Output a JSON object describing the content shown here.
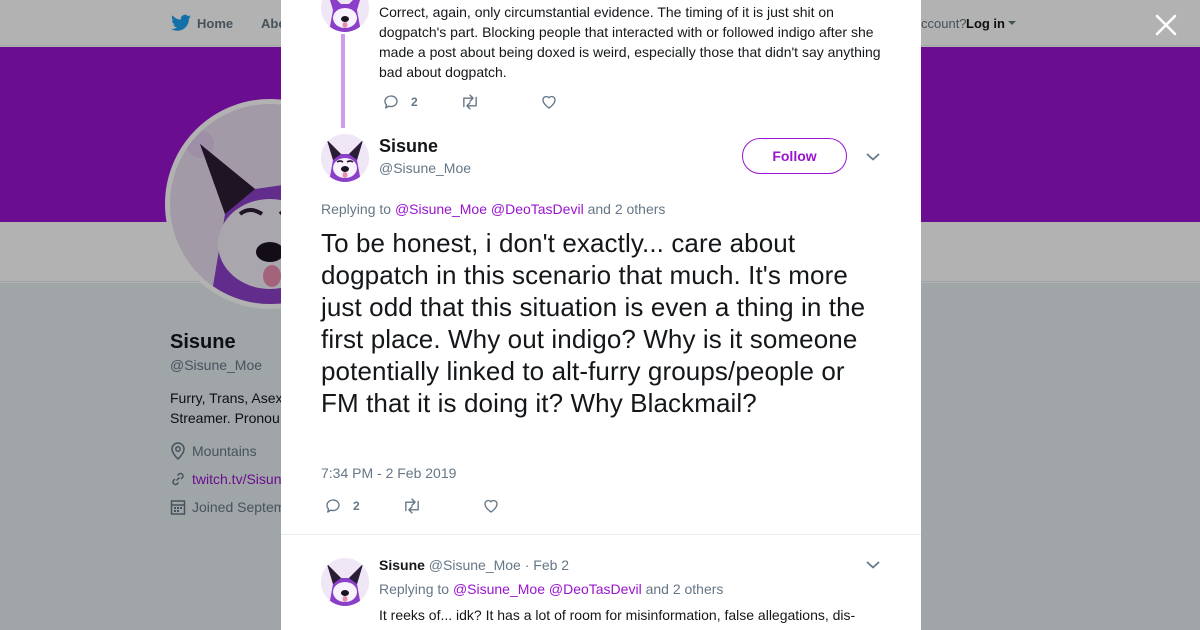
{
  "nav": {
    "home": "Home",
    "about": "Abo",
    "account_prompt": "ccount?",
    "login": "Log in"
  },
  "profile": {
    "name": "Sisune",
    "handle": "@Sisune_Moe",
    "bio_line1": "Furry, Trans, Asex",
    "bio_line2": "Streamer. Pronou",
    "location": "Mountains",
    "link": "twitch.tv/Sisun",
    "joined": "Joined Septem"
  },
  "colors": {
    "brand": "#9a14cf",
    "thread_line": "#cf9bec",
    "secondary_text": "#657786"
  },
  "previous_tweet": {
    "text": "Correct, again, only circumstantial evidence. The timing of it is just shit on dogpatch's part. Blocking people that interacted with or followed indigo after she made a post about being doxed is weird, especially those that didn't say anything bad about dogpatch.",
    "reply_count": "2",
    "retweet_count": "",
    "like_count": ""
  },
  "main_tweet": {
    "name": "Sisune",
    "handle": "@Sisune_Moe",
    "follow_label": "Follow",
    "replying_prefix": "Replying to",
    "mention1": "@Sisune_Moe",
    "mention2": "@DeoTasDevil",
    "replying_suffix": "and 2 others",
    "text": "To be honest, i don't exactly... care about dogpatch in this scenario that much. It's more just odd that this situation is even a thing in the first place. Why out indigo? Why is it someone potentially linked to alt-furry groups/people or FM that it is doing it? Why Blackmail?",
    "timestamp": "7:34 PM - 2 Feb 2019",
    "reply_count": "2",
    "retweet_count": "",
    "like_count": ""
  },
  "reply_tweet": {
    "name": "Sisune",
    "handle": "@Sisune_Moe",
    "date": "· Feb 2",
    "replying_prefix": "Replying to",
    "mention1": "@Sisune_Moe",
    "mention2": "@DeoTasDevil",
    "replying_suffix": "and 2 others",
    "text": "It reeks of... idk? It has a lot of room for misinformation, false allegations, dis-politics, and fighting. It just looks both vs the entire scenario potentially backwards"
  }
}
